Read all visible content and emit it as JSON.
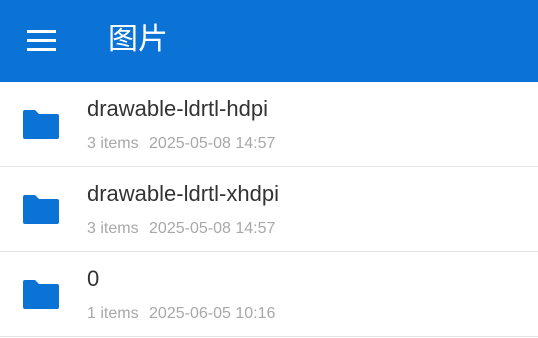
{
  "app_bar": {
    "title": "图片",
    "menu_icon": "hamburger-menu-icon",
    "background_color": "#0B72D6"
  },
  "folders": [
    {
      "name": "drawable-ldrtl-hdpi",
      "count": "3 items",
      "modified": "2025-05-08 14:57",
      "icon": "folder-icon"
    },
    {
      "name": "drawable-ldrtl-xhdpi",
      "count": "3 items",
      "modified": "2025-05-08 14:57",
      "icon": "folder-icon"
    },
    {
      "name": "0",
      "count": "1 items",
      "modified": "2025-06-05 10:16",
      "icon": "folder-icon"
    }
  ],
  "colors": {
    "folder_icon": "#0B72D6",
    "primary_text": "#333333",
    "secondary_text": "#A8A8A8",
    "divider": "#E3E3E3"
  }
}
